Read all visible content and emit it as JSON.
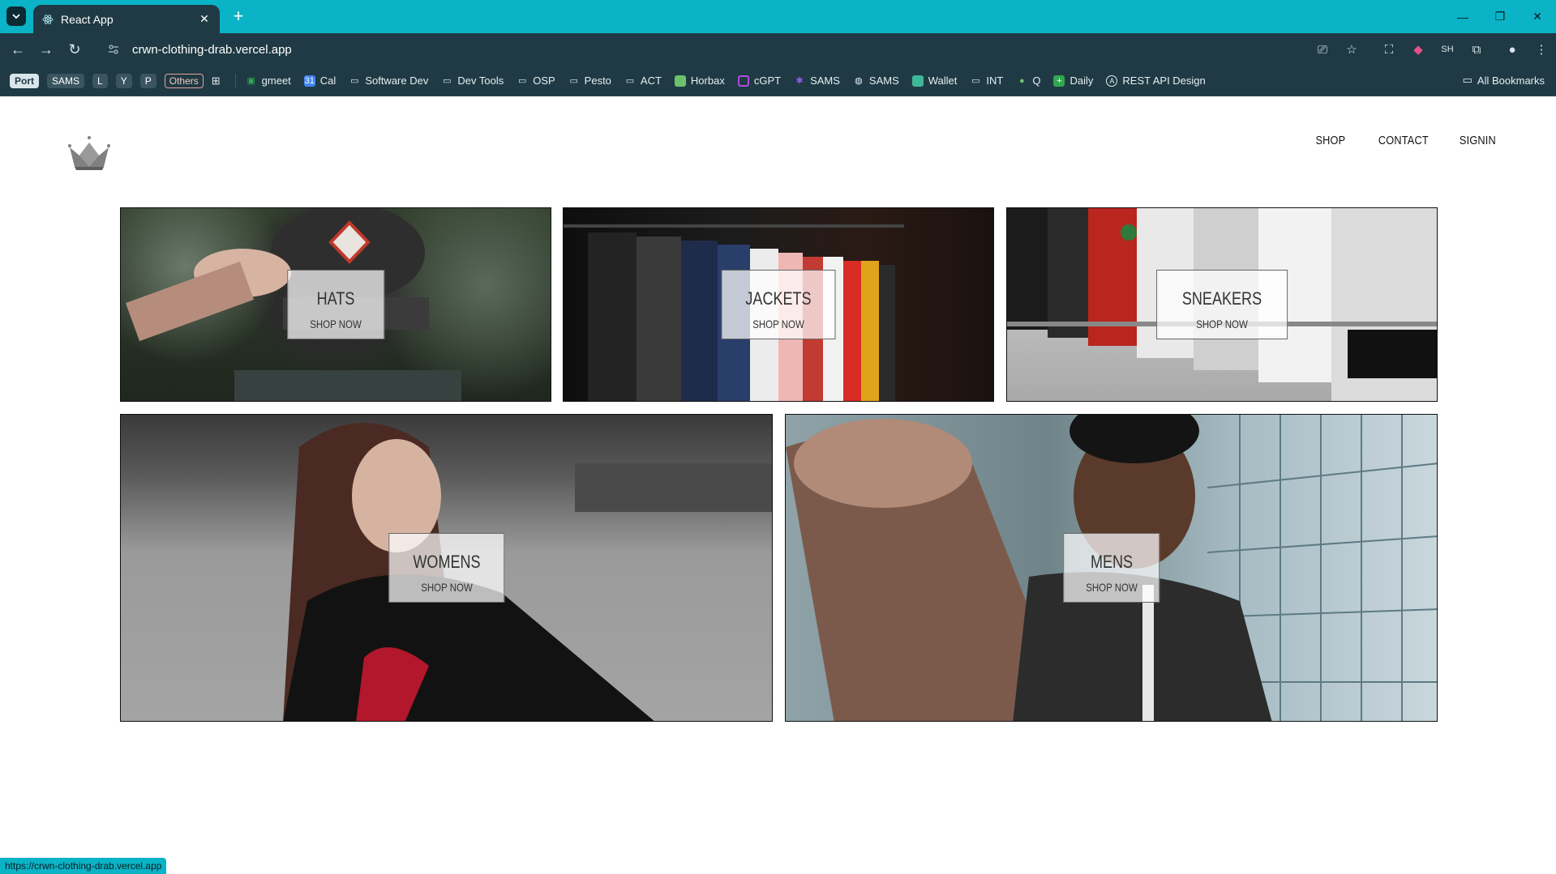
{
  "browser": {
    "tab_title": "React App",
    "url": "crwn-clothing-drab.vercel.app",
    "status_url": "https://crwn-clothing-drab.vercel.app",
    "bookmarks_pills": [
      "Port",
      "SAMS",
      "L",
      "Y",
      "P",
      "Others"
    ],
    "bookmarks": [
      {
        "label": "gmeet",
        "icon": "gmeet-icon"
      },
      {
        "label": "Cal",
        "icon": "calendar-icon"
      },
      {
        "label": "Software Dev",
        "icon": "folder-icon"
      },
      {
        "label": "Dev Tools",
        "icon": "folder-icon"
      },
      {
        "label": "OSP",
        "icon": "folder-icon"
      },
      {
        "label": "Pesto",
        "icon": "folder-icon"
      },
      {
        "label": "ACT",
        "icon": "folder-icon"
      },
      {
        "label": "Horbax",
        "icon": "horbax-icon"
      },
      {
        "label": "cGPT",
        "icon": "cgpt-icon"
      },
      {
        "label": "SAMS",
        "icon": "sams-icon"
      },
      {
        "label": "SAMS",
        "icon": "globe-icon"
      },
      {
        "label": "Wallet",
        "icon": "wallet-icon"
      },
      {
        "label": "INT",
        "icon": "folder-icon"
      },
      {
        "label": "Q",
        "icon": "q-icon"
      },
      {
        "label": "Daily",
        "icon": "daily-icon"
      },
      {
        "label": "REST API Design",
        "icon": "api-icon"
      }
    ],
    "all_bookmarks": "All Bookmarks"
  },
  "nav": {
    "shop": "SHOP",
    "contact": "CONTACT",
    "signin": "SIGNIN"
  },
  "categories": [
    {
      "title": "HATS",
      "subtitle": "SHOP NOW"
    },
    {
      "title": "JACKETS",
      "subtitle": "SHOP NOW"
    },
    {
      "title": "SNEAKERS",
      "subtitle": "SHOP NOW"
    },
    {
      "title": "WOMENS",
      "subtitle": "SHOP NOW"
    },
    {
      "title": "MENS",
      "subtitle": "SHOP NOW"
    }
  ],
  "colors": {
    "chrome_accent": "#0ab3c5",
    "chrome_dark": "#1f3a44"
  }
}
